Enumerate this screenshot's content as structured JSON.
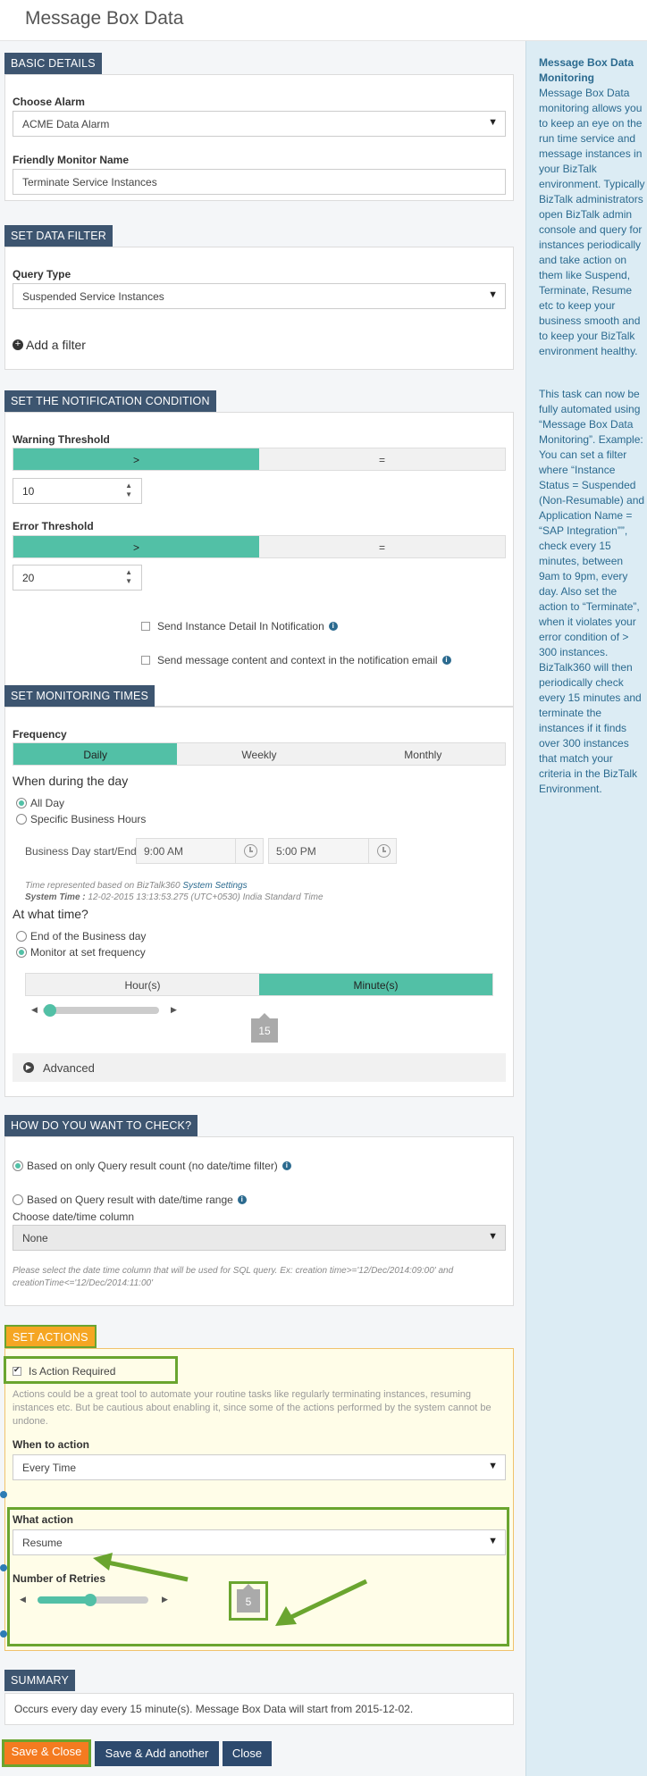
{
  "window": {
    "title": "Message Box Data"
  },
  "basic_details": {
    "header": "BASIC DETAILS",
    "alarm_label": "Choose Alarm",
    "alarm_value": "ACME Data Alarm",
    "name_label": "Friendly Monitor Name",
    "name_value": "Terminate Service Instances"
  },
  "data_filter": {
    "header": "SET DATA FILTER",
    "query_label": "Query Type",
    "query_value": "Suspended Service Instances",
    "add_filter": "Add a filter"
  },
  "notification": {
    "header": "SET THE NOTIFICATION CONDITION",
    "warning_label": "Warning Threshold",
    "warning_ops": [
      ">",
      "="
    ],
    "warning_value": "10",
    "error_label": "Error Threshold",
    "error_ops": [
      ">",
      "="
    ],
    "error_value": "20",
    "send_detail": "Send Instance Detail In Notification",
    "send_content": "Send message content and context in the notification email"
  },
  "monitoring": {
    "header": "SET MONITORING TIMES",
    "frequency_label": "Frequency",
    "freq_options": [
      "Daily",
      "Weekly",
      "Monthly"
    ],
    "when_label": "When during the day",
    "all_day": "All Day",
    "specific_hours": "Specific Business Hours",
    "business_label": "Business Day start/End",
    "start_time": "9:00 AM",
    "end_time": "5:00 PM",
    "time_note_prefix": "Time represented based on BizTalk360",
    "time_note_link": "System Settings",
    "system_time_label": "System Time :",
    "system_time_value": "12-02-2015 13:13:53.275 (UTC+0530) India Standard Time",
    "at_what_time": "At what time?",
    "end_of_day": "End of the Business day",
    "set_frequency": "Monitor at set frequency",
    "unit_options": [
      "Hour(s)",
      "Minute(s)"
    ],
    "slider_value": "15",
    "advanced": "Advanced"
  },
  "check": {
    "header": "HOW DO YOU WANT TO CHECK?",
    "option_count": "Based on only Query result count (no date/time filter)",
    "option_range": "Based on Query result with date/time range",
    "column_label": "Choose date/time column",
    "column_value": "None",
    "note": "Please select the date time column that will be used for SQL query. Ex: creation time>='12/Dec/2014:09:00' and creationTime<='12/Dec/2014:11:00'"
  },
  "actions": {
    "header": "SET ACTIONS",
    "required_label": "Is Action Required",
    "description": "Actions could be a great tool to automate your routine tasks like regularly terminating instances, resuming instances etc. But be cautious about enabling it, since some of the actions performed by the system cannot be undone.",
    "when_label": "When to action",
    "when_value": "Every Time",
    "what_label": "What action",
    "what_value": "Resume",
    "retries_label": "Number of Retries",
    "retries_value": "5"
  },
  "summary": {
    "header": "SUMMARY",
    "text": "Occurs every day every 15 minute(s). Message Box Data will start from 2015-12-02."
  },
  "buttons": {
    "save_close": "Save & Close",
    "save_add": "Save & Add another",
    "close": "Close"
  },
  "sidebar": {
    "title": "Message Box Data Monitoring",
    "para1": "Message Box Data monitoring allows you to keep an eye on the run time service and message instances in your BizTalk environment. Typically BizTalk administrators open BizTalk admin console and query for instances periodically and take action on them like Suspend, Terminate, Resume etc to keep your business smooth and to keep your BizTalk environment healthy.",
    "para2": "This task can now be fully automated using “Message Box Data Monitoring”. Example: You can set a filter where “Instance Status = Suspended (Non-Resumable) and Application Name = “SAP Integration””, check every 15 minutes, between 9am to 9pm, every day. Also set the action to “Terminate”, when it violates your error condition of > 300 instances. BizTalk360 will then periodically check every 15 minutes and terminate the instances if it finds over 300 instances that match your criteria in the BizTalk Environment."
  },
  "colors": {
    "accent": "#52c0a6",
    "header_bg": "#3d5570",
    "sidebar_bg": "#dcecf4",
    "action_header": "#f5a623",
    "highlight": "#6aa52f",
    "save_button": "#f47b20"
  }
}
